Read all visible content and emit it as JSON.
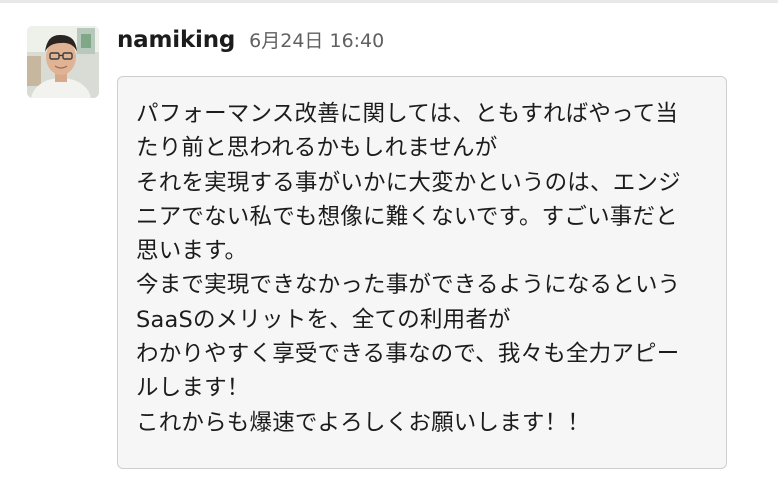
{
  "message": {
    "author": "namiking",
    "timestamp": "6月24日 16:40",
    "lines": [
      "パフォーマンス改善に関しては、ともすればやって当",
      "たり前と思われるかもしれませんが",
      "それを実現する事がいかに大変かというのは、エンジ",
      "ニアでない私でも想像に難くないです。すごい事だと",
      "思います。",
      "今まで実現できなかった事ができるようになるという",
      "SaaSのメリットを、全ての利用者が",
      "わかりやすく享受できる事なので、我々も全力アピー",
      "ルします！",
      "これからも爆速でよろしくお願いします！！"
    ]
  },
  "colors": {
    "author": "#1d1c1d",
    "timestamp": "#616061",
    "bubble_background": "#f6f6f6",
    "bubble_border": "#cfcfcf"
  }
}
